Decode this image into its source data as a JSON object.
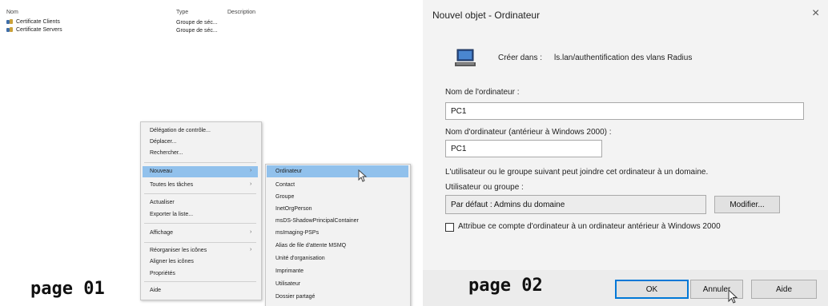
{
  "left": {
    "columns": {
      "name": "Nom",
      "type": "Type",
      "description": "Description"
    },
    "rows": [
      {
        "name": "Certificate Clients",
        "type": "Groupe de séc..."
      },
      {
        "name": "Certificate Servers",
        "type": "Groupe de séc..."
      }
    ],
    "context_menu": {
      "items": [
        {
          "label": "Délégation de contrôle..."
        },
        {
          "label": "Déplacer..."
        },
        {
          "label": "Rechercher..."
        },
        {
          "label": "Nouveau",
          "has_submenu": true,
          "selected": true
        },
        {
          "label": "Toutes les tâches",
          "has_submenu": true
        },
        {
          "label": "Actualiser"
        },
        {
          "label": "Exporter la liste..."
        },
        {
          "label": "Affichage",
          "has_submenu": true
        },
        {
          "label": "Réorganiser les icônes",
          "has_submenu": true
        },
        {
          "label": "Aligner les icônes"
        },
        {
          "label": "Propriétés"
        },
        {
          "label": "Aide"
        }
      ]
    },
    "submenu": {
      "items": [
        {
          "label": "Ordinateur",
          "selected": true
        },
        {
          "label": "Contact"
        },
        {
          "label": "Groupe"
        },
        {
          "label": "InetOrgPerson"
        },
        {
          "label": "msDS-ShadowPrincipalContainer"
        },
        {
          "label": "msImaging-PSPs"
        },
        {
          "label": "Alias de file d'attente MSMQ"
        },
        {
          "label": "Unité d'organisation"
        },
        {
          "label": "Imprimante"
        },
        {
          "label": "Utilisateur"
        },
        {
          "label": "Dossier partagé"
        }
      ]
    },
    "page_label": "page 01"
  },
  "dialog": {
    "title": "Nouvel objet - Ordinateur",
    "close_glyph": "×",
    "create_in_label": "Créer dans :",
    "create_in_value": "ls.lan/authentification des vlans Radius",
    "computer_name_label": "Nom de l'ordinateur :",
    "computer_name_value": "PC1",
    "pre2000_label": "Nom d'ordinateur (antérieur à Windows 2000) :",
    "pre2000_value": "PC1",
    "join_info": "L'utilisateur ou le groupe suivant peut joindre cet ordinateur à un domaine.",
    "user_group_label": "Utilisateur ou groupe :",
    "user_group_value": "Par défaut : Admins du domaine",
    "modify_label": "Modifier...",
    "checkbox_label": "Attribue ce compte d'ordinateur à un ordinateur antérieur à Windows 2000",
    "checkbox_checked": false,
    "ok_label": "OK",
    "cancel_label": "Annuler",
    "help_label": "Aide",
    "page_label": "page 02",
    "accent_color": "#0078d7",
    "selection_color": "#91c1ec"
  }
}
